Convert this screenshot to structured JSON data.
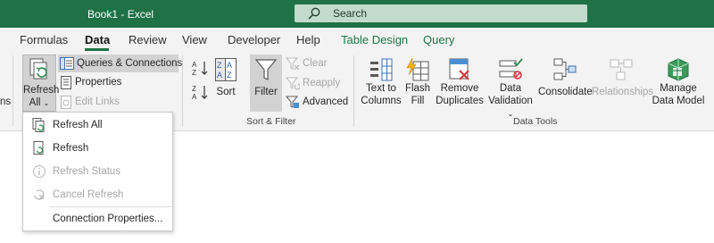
{
  "window": {
    "doc_title": "Book1  -  Excel",
    "search_placeholder": "Search"
  },
  "tabs": [
    {
      "label": "Formulas"
    },
    {
      "label": "Data",
      "active": true
    },
    {
      "label": "Review"
    },
    {
      "label": "View"
    },
    {
      "label": "Developer"
    },
    {
      "label": "Help"
    },
    {
      "label": "Table Design",
      "contextual": true
    },
    {
      "label": "Query",
      "contextual": true
    }
  ],
  "ribbon": {
    "left_clip_text": "ns",
    "queries_group": {
      "refresh_all_line1": "Refresh",
      "refresh_all_line2": "All",
      "queries_connections": "Queries & Connections",
      "properties": "Properties",
      "edit_links": "Edit Links"
    },
    "sort_filter": {
      "sort_label": "Sort",
      "filter_label": "Filter",
      "clear_label": "Clear",
      "reapply_label": "Reapply",
      "advanced_label": "Advanced",
      "group_label": "Sort & Filter"
    },
    "data_tools": {
      "text_to_columns_line1": "Text to",
      "text_to_columns_line2": "Columns",
      "flash_fill_line1": "Flash",
      "flash_fill_line2": "Fill",
      "remove_duplicates_line1": "Remove",
      "remove_duplicates_line2": "Duplicates",
      "data_validation_line1": "Data",
      "data_validation_line2": "Validation",
      "consolidate_label": "Consolidate",
      "relationships_label": "Relationships",
      "manage_model_line1": "Manage",
      "manage_model_line2": "Data Model",
      "group_label": "Data Tools"
    }
  },
  "refresh_menu": {
    "items": [
      {
        "label": "Refresh All",
        "enabled": true
      },
      {
        "label": "Refresh",
        "enabled": true
      },
      {
        "label": "Refresh Status",
        "enabled": false
      },
      {
        "label": "Cancel Refresh",
        "enabled": false
      },
      {
        "label": "Connection Properties...",
        "enabled": true
      }
    ]
  },
  "colors": {
    "title_bar": "#1f7246",
    "contextual_tab": "#1c7446",
    "ribbon_bg": "#f3f3f3",
    "disabled_text": "#a6a6a6"
  },
  "icons": [
    "search-icon",
    "refresh-all-icon",
    "queries-connections-icon",
    "properties-icon",
    "edit-links-icon",
    "sort-az-icon",
    "sort-za-icon",
    "sort-icon",
    "filter-icon",
    "clear-filter-icon",
    "reapply-icon",
    "advanced-filter-icon",
    "text-to-columns-icon",
    "flash-fill-icon",
    "remove-duplicates-icon",
    "data-validation-icon",
    "consolidate-icon",
    "relationships-icon",
    "manage-data-model-icon"
  ]
}
